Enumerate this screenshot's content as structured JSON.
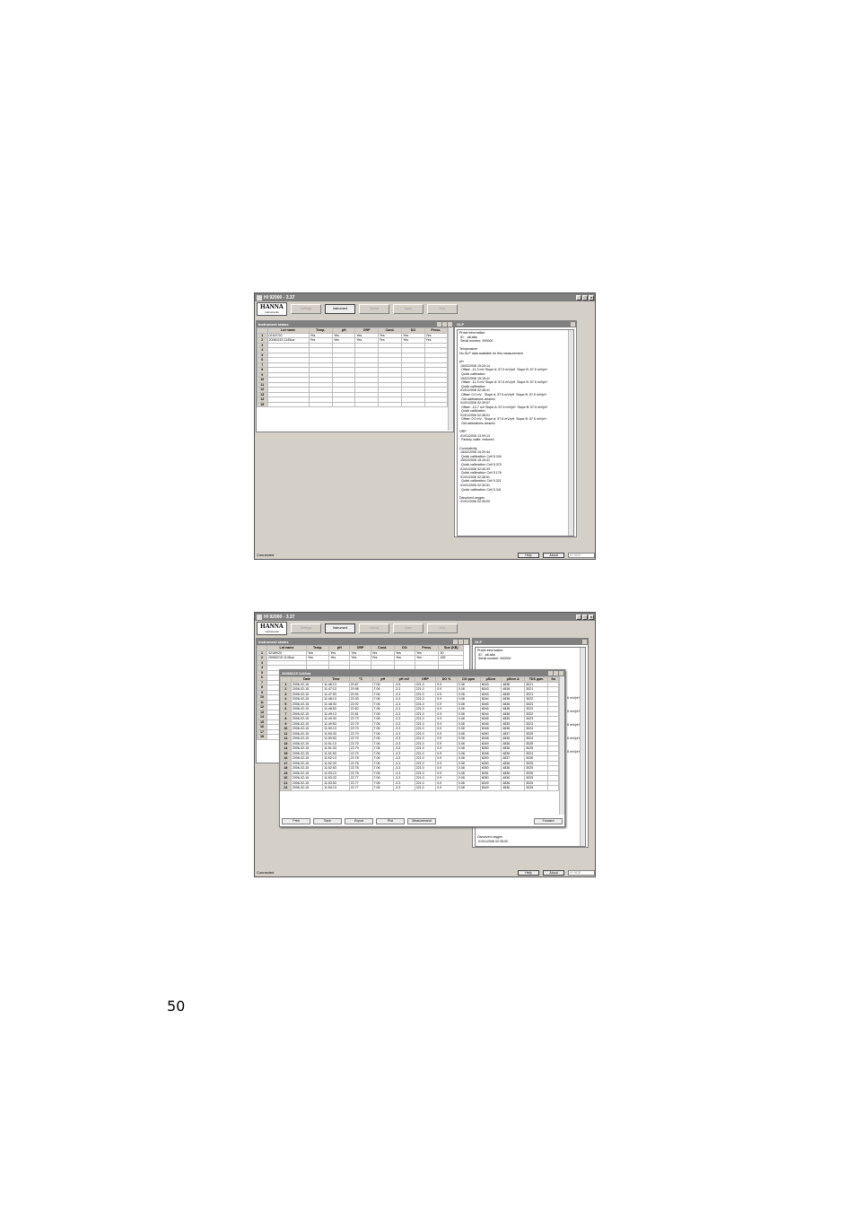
{
  "page_number": "50",
  "app": {
    "title": "HI 92000 - 3.37",
    "logo": "HANNA",
    "logo_sub": "instruments",
    "toolbar": [
      "Settings",
      "Instrument",
      "Get lot",
      "Open",
      "Exit"
    ],
    "status": "Connected",
    "help_label": "Help",
    "about_label": "About",
    "port_label": "HI 9828"
  },
  "shot1": {
    "instrument_status": {
      "title": "Instrument status",
      "columns": [
        "",
        "Lot name",
        "Temp.",
        "pH",
        "ORP",
        "Cond.",
        "DO",
        "Press."
      ],
      "rows": [
        [
          "1",
          "02187/20",
          "Yes",
          "Yes",
          "Yes",
          "Yes",
          "Yes",
          "Yes"
        ],
        [
          "2",
          "20060215 1145oa",
          "Yes",
          "Yes",
          "Yes",
          "Yes",
          "Yes",
          "Yes"
        ],
        [
          "3",
          "",
          "",
          "",
          "",
          "",
          "",
          ""
        ],
        [
          "4",
          "",
          "",
          "",
          "",
          "",
          "",
          ""
        ],
        [
          "5",
          "",
          "",
          "",
          "",
          "",
          "",
          ""
        ],
        [
          "6",
          "",
          "",
          "",
          "",
          "",
          "",
          ""
        ],
        [
          "7",
          "",
          "",
          "",
          "",
          "",
          "",
          ""
        ],
        [
          "8",
          "",
          "",
          "",
          "",
          "",
          "",
          ""
        ],
        [
          "9",
          "",
          "",
          "",
          "",
          "",
          "",
          ""
        ],
        [
          "10",
          "",
          "",
          "",
          "",
          "",
          "",
          ""
        ],
        [
          "11",
          "",
          "",
          "",
          "",
          "",
          "",
          ""
        ],
        [
          "12",
          "",
          "",
          "",
          "",
          "",
          "",
          ""
        ],
        [
          "13",
          "",
          "",
          "",
          "",
          "",
          "",
          ""
        ],
        [
          "14",
          "",
          "",
          "",
          "",
          "",
          "",
          ""
        ],
        [
          "15",
          "",
          "",
          "",
          "",
          "",
          "",
          ""
        ]
      ]
    },
    "glp": {
      "title": "GLP",
      "text": "Probe information\n ID:   a8.a8a\n Serial number: 000000\n\nTemperature\nNo GLP data available for this measurement\n\npH\n 15/02/2006 15:20:14\n  Offset: -11.3 mV Slope A: 57.5 mV/pH  Slope B: 57.5 mV/pH\n  Quick calibration\n 15/02/2006 15:18:41\n  Offset: -11.3 mV Slope A: 57.5 mV/pH  Slope B: 57.5 mV/pH\n  Quick calibration\n 01/01/2006 02:48:41\n  Offset: 0.0 mV   Slope A: 57.5 mV/pH  Slope B: 57.5 mV/pH\n  Old calibrations cleared\n 01/01/2006 02:39:07\n  Offset: -10.7 mV Slope A: 57.5 mV/pH  Slope B: 57.5 mV/pH\n  Quick calibration\n 01/01/2006 02:38:01\n  Offset: 0.0 mV   Slope A: 57.5 mV/pH  Slope B: 57.5 mV/pH\n  Old calibrations cleared\n\nORP\n 01/01/2006 13:09:13\n  Factory calibr. restored\n\nConductivity\n 15/02/2006 15:20:44\n  Quick calibration: Cell 5.344\n 15/02/2006 15:19:31\n  Quick calibration: Cell 5.370\n 01/01/2006 02:40:33\n  Quick calibration: Cell 5.176\n 01/01/2006 02:38:51\n  Quick calibration: Cell 5.321\n 01/01/2006 02:30:51\n  Quick calibration: Cell 5.341\n\nDissolved oxygen\n 01/01/2006 02:35:00"
    }
  },
  "shot2": {
    "instrument_status": {
      "title": "Instrument status",
      "columns": [
        "",
        "Lot name",
        "Temp.",
        "pH",
        "ORP",
        "Cond.",
        "DO",
        "Press.",
        "Size (KB)"
      ],
      "rows": [
        [
          "1",
          "02189/20",
          "Yes",
          "Yes",
          "Yes",
          "Yes",
          "Yes",
          "Yes",
          "40"
        ],
        [
          "2",
          "20060215 1145oa",
          "Yes",
          "Yes",
          "Yes",
          "Yes",
          "Yes",
          "Yes",
          "182"
        ],
        [
          "3"
        ],
        [
          "4"
        ],
        [
          "5"
        ],
        [
          "6"
        ],
        [
          "7"
        ],
        [
          "8"
        ],
        [
          "9"
        ],
        [
          "10"
        ],
        [
          "11"
        ],
        [
          "12"
        ],
        [
          "13"
        ],
        [
          "14"
        ],
        [
          "15"
        ],
        [
          "16"
        ],
        [
          "17"
        ],
        [
          "18"
        ]
      ]
    },
    "glp": {
      "title": "GLP",
      "text": "Probe information\n ID:   a8.a8a\n Serial number: 000000",
      "side_lines": [
        "5 mV/pH",
        "5 mV/pH",
        "5 mV/pH",
        "5 mV/pH",
        "5 mV/pH"
      ],
      "bottom_text": "Dissolved oxygen\n 01/01/2006 02:35:00"
    },
    "lot_window": {
      "title": "20060215 1145oa",
      "columns": [
        "",
        "Date",
        "Time",
        "°C",
        "pH",
        "pH mV",
        "ORP",
        "DO %",
        "DO ppm",
        "µS/cm",
        "µS/cm A",
        "TDS ppm",
        "Sa"
      ],
      "rows": [
        [
          "1",
          "2006-02-15",
          "11:46:13",
          "20.87",
          "7.06",
          "-3.5",
          "221.0",
          "0.9",
          "0.08",
          "6043",
          "4836",
          "3021"
        ],
        [
          "2",
          "2006-02-15",
          "11:47:13",
          "20.98",
          "7.06",
          "-3.3",
          "221.0",
          "0.9",
          "0.08",
          "6043",
          "4836",
          "3021"
        ],
        [
          "3",
          "2006-02-15",
          "11:47:53",
          "20.94",
          "7.06",
          "-3.3",
          "221.0",
          "0.9",
          "0.08",
          "6043",
          "4836",
          "3021"
        ],
        [
          "4",
          "2006-02-15",
          "11:48:13",
          "22.93",
          "7.06",
          "-3.3",
          "221.0",
          "0.9",
          "0.08",
          "6044",
          "4836",
          "3022"
        ],
        [
          "5",
          "2006-02-15",
          "11:48:33",
          "22.92",
          "7.06",
          "-3.3",
          "221.0",
          "0.9",
          "0.08",
          "6045",
          "4836",
          "3023"
        ],
        [
          "6",
          "2006-02-15",
          "11:48:53",
          "22.82",
          "7.06",
          "-3.3",
          "221.0",
          "0.9",
          "0.08",
          "6045",
          "4836",
          "3023"
        ],
        [
          "7",
          "2006-02-15",
          "11:49:13",
          "22.81",
          "7.06",
          "-3.3",
          "221.0",
          "0.9",
          "0.08",
          "6044",
          "4836",
          "3022"
        ],
        [
          "8",
          "2006-02-15",
          "11:49:33",
          "22.79",
          "7.06",
          "-3.3",
          "221.0",
          "0.9",
          "0.08",
          "6046",
          "4835",
          "3023"
        ],
        [
          "9",
          "2006-02-15",
          "11:49:53",
          "22.79",
          "7.06",
          "-3.3",
          "221.0",
          "0.9",
          "0.08",
          "6046",
          "4835",
          "3023"
        ],
        [
          "10",
          "2006-02-15",
          "11:50:13",
          "22.79",
          "7.06",
          "-3.3",
          "221.0",
          "0.9",
          "0.08",
          "6048",
          "4836",
          "3024"
        ],
        [
          "11",
          "2006-02-15",
          "11:50:33",
          "22.79",
          "7.06",
          "-3.3",
          "221.0",
          "0.9",
          "0.08",
          "6050",
          "4837",
          "3025"
        ],
        [
          "12",
          "2006-02-15",
          "11:50:53",
          "22.79",
          "7.06",
          "-3.3",
          "221.0",
          "0.9",
          "0.08",
          "6048",
          "4836",
          "3024"
        ],
        [
          "13",
          "2006-02-15",
          "11:51:13",
          "22.79",
          "7.06",
          "-3.3",
          "221.0",
          "0.9",
          "0.08",
          "6049",
          "4836",
          "3025"
        ],
        [
          "14",
          "2006-02-15",
          "11:51:33",
          "22.79",
          "7.06",
          "-3.3",
          "221.0",
          "0.9",
          "0.08",
          "6050",
          "4836",
          "3025"
        ],
        [
          "15",
          "2006-02-15",
          "11:51:53",
          "22.79",
          "7.06",
          "-3.3",
          "221.0",
          "0.9",
          "0.08",
          "6048",
          "4836",
          "3024"
        ],
        [
          "16",
          "2006-02-15",
          "11:52:13",
          "22.78",
          "7.06",
          "-3.3",
          "221.0",
          "0.9",
          "0.08",
          "6053",
          "4837",
          "3026"
        ],
        [
          "17",
          "2006-02-15",
          "11:52:33",
          "22.78",
          "7.06",
          "-3.3",
          "221.0",
          "0.9",
          "0.08",
          "6050",
          "4836",
          "3025"
        ],
        [
          "18",
          "2006-02-15",
          "11:52:53",
          "22.78",
          "7.06",
          "-3.3",
          "221.0",
          "0.9",
          "0.08",
          "6050",
          "4836",
          "3025"
        ],
        [
          "19",
          "2006-02-15",
          "11:53:13",
          "22.78",
          "7.06",
          "-3.3",
          "221.0",
          "0.9",
          "0.08",
          "6051",
          "4836",
          "3026"
        ],
        [
          "20",
          "2006-02-15",
          "11:53:33",
          "22.77",
          "7.06",
          "-3.3",
          "221.0",
          "0.9",
          "0.08",
          "6050",
          "4836",
          "3025"
        ],
        [
          "21",
          "2006-02-15",
          "11:53:53",
          "22.77",
          "7.06",
          "-3.3",
          "221.0",
          "0.9",
          "0.08",
          "6049",
          "4836",
          "3025"
        ],
        [
          "22",
          "2006-02-15",
          "11:54:13",
          "22.77",
          "7.06",
          "-3.3",
          "221.0",
          "0.9",
          "0.08",
          "6049",
          "4836",
          "3025"
        ]
      ],
      "buttons": [
        "Print",
        "Save",
        "Export",
        "Plot",
        "Measurement"
      ],
      "forward": "Forward"
    }
  }
}
